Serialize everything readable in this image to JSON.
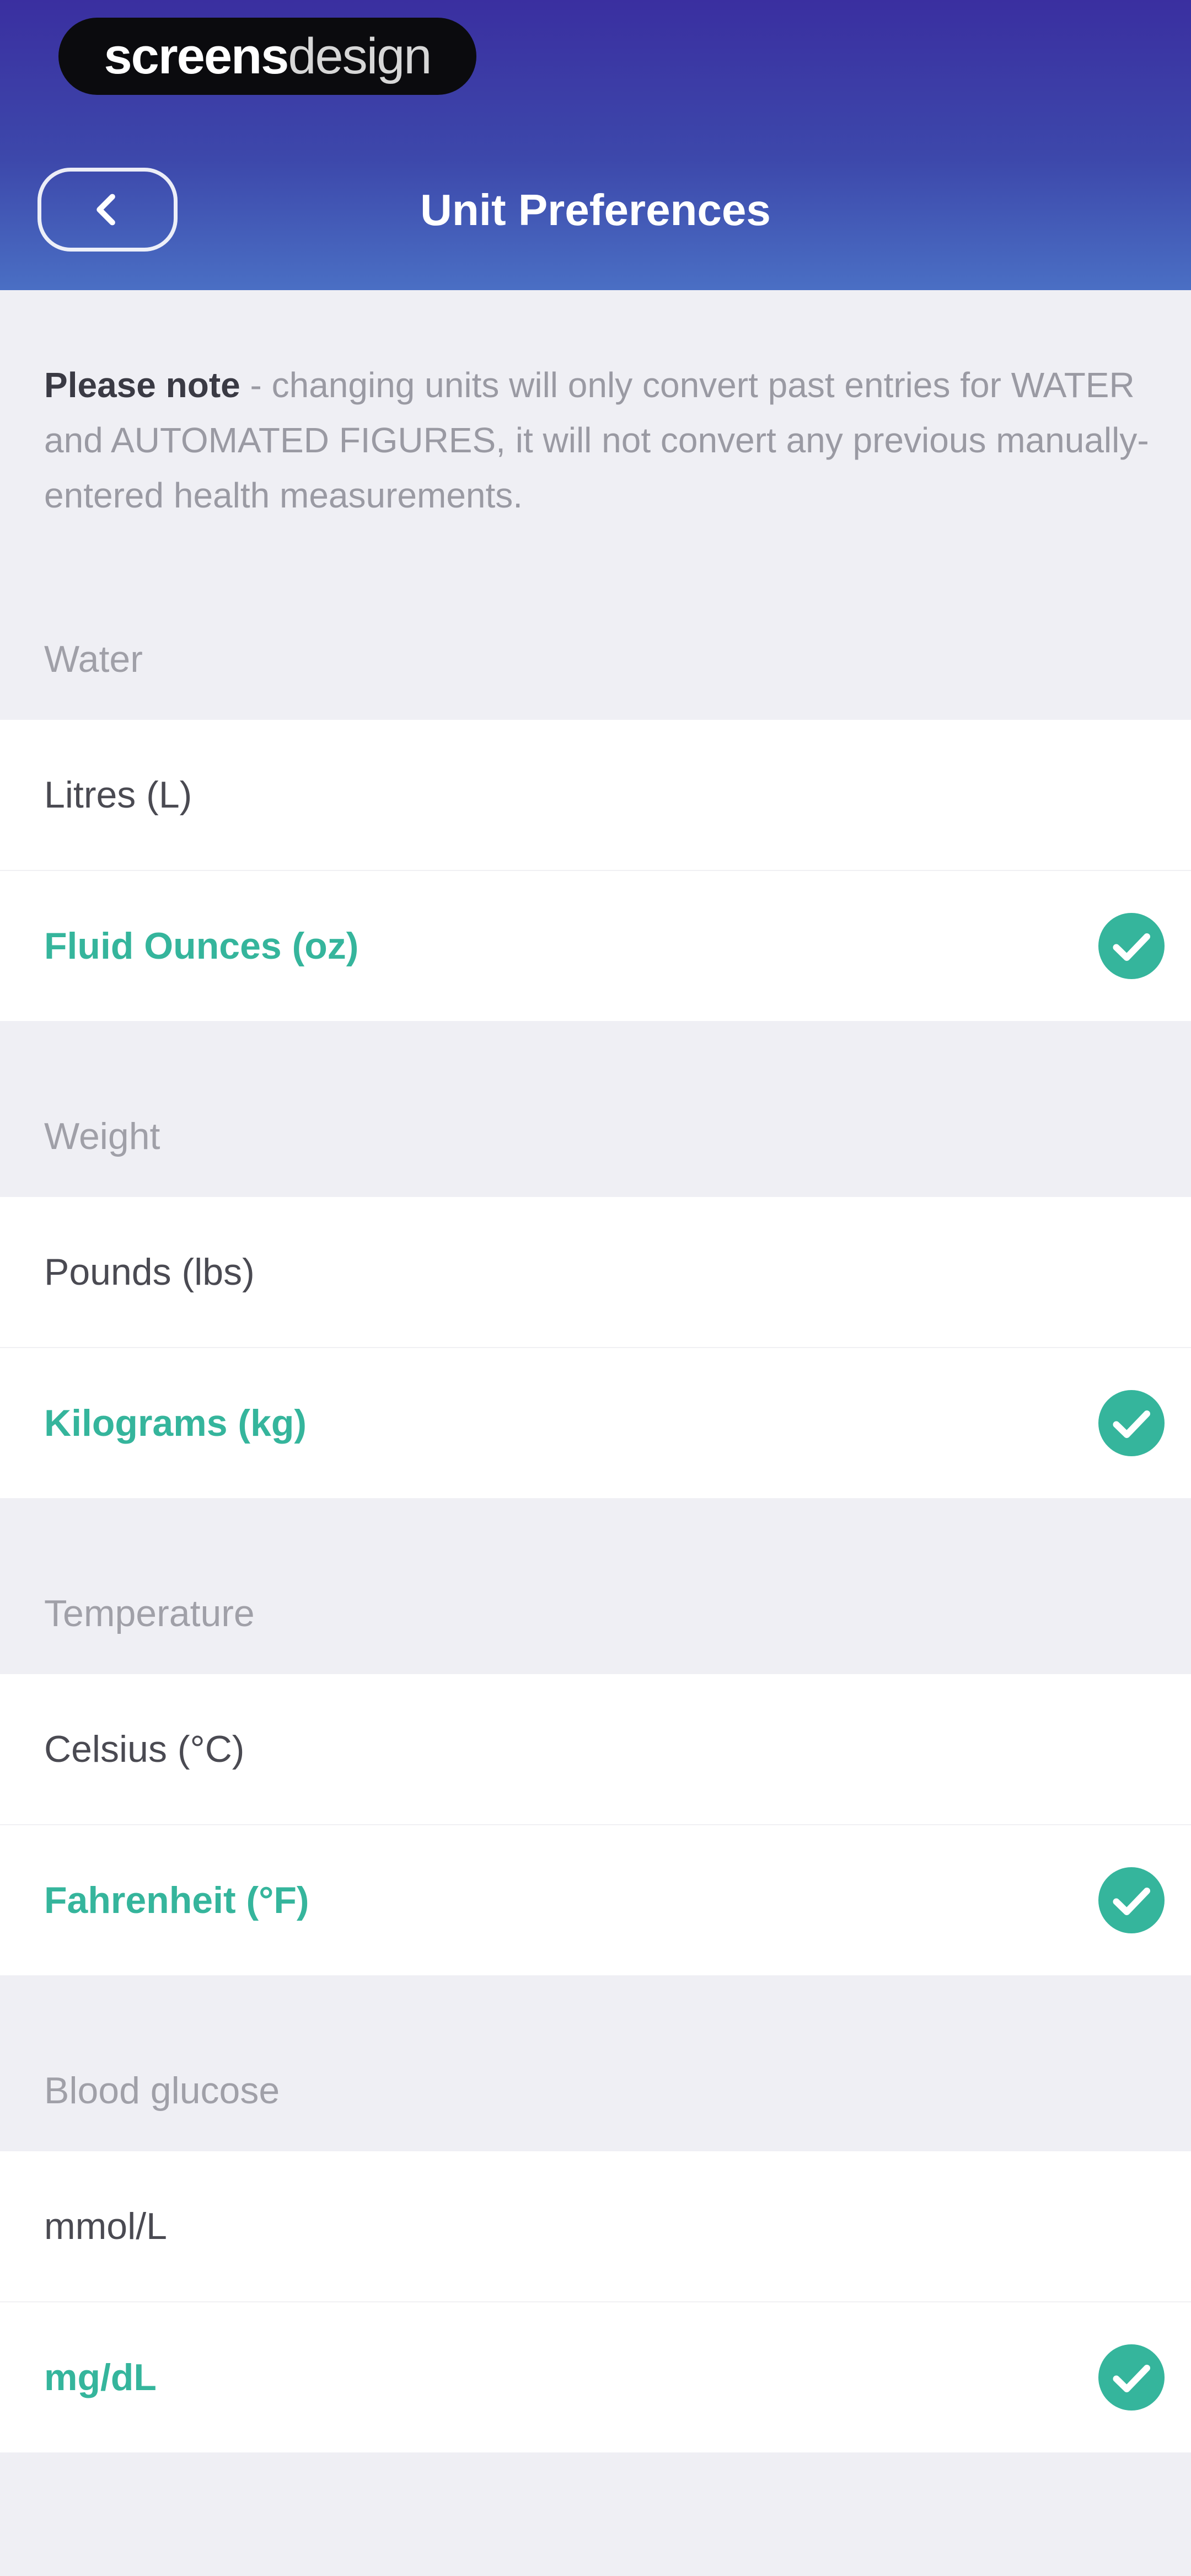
{
  "brand": {
    "name_strong": "screens",
    "name_light": "design"
  },
  "header": {
    "title": "Unit Preferences"
  },
  "note": {
    "bold": "Please note",
    "text": " - changing units will only convert past entries for WATER and AUTOMATED FIGURES, it will not convert any previous manually-entered health measurements."
  },
  "sections": [
    {
      "label": "Water",
      "options": [
        "Litres (L)",
        "Fluid Ounces (oz)"
      ],
      "selected_index": 1
    },
    {
      "label": "Weight",
      "options": [
        "Pounds (lbs)",
        "Kilograms (kg)"
      ],
      "selected_index": 1
    },
    {
      "label": "Temperature",
      "options": [
        "Celsius (°C)",
        "Fahrenheit (°F)"
      ],
      "selected_index": 1
    },
    {
      "label": "Blood glucose",
      "options": [
        "mmol/L",
        "mg/dL"
      ],
      "selected_index": 1
    }
  ],
  "icons": {
    "back": "chevron-left-icon",
    "selected": "check-circle-icon"
  },
  "colors": {
    "header_top": "#3a2fa0",
    "header_bottom": "#4a6fc4",
    "accent": "#35b59c",
    "background": "#efeff4"
  }
}
